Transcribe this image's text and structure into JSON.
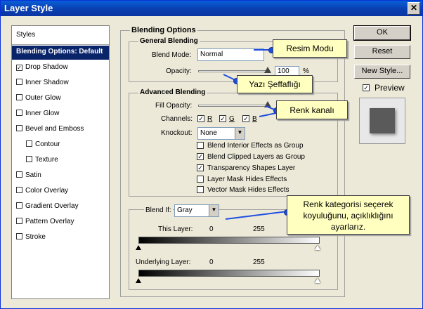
{
  "window": {
    "title": "Layer Style",
    "close_glyph": "✕"
  },
  "styles_panel": {
    "items": [
      {
        "label": "Styles",
        "checked": null,
        "selected": false
      },
      {
        "label": "Blending Options: Default",
        "checked": null,
        "selected": true
      },
      {
        "label": "Drop Shadow",
        "checked": true,
        "selected": false
      },
      {
        "label": "Inner Shadow",
        "checked": false,
        "selected": false
      },
      {
        "label": "Outer Glow",
        "checked": false,
        "selected": false
      },
      {
        "label": "Inner Glow",
        "checked": false,
        "selected": false
      },
      {
        "label": "Bevel and Emboss",
        "checked": false,
        "selected": false
      },
      {
        "label": "Contour",
        "checked": false,
        "selected": false
      },
      {
        "label": "Texture",
        "checked": false,
        "selected": false
      },
      {
        "label": "Satin",
        "checked": false,
        "selected": false
      },
      {
        "label": "Color Overlay",
        "checked": false,
        "selected": false
      },
      {
        "label": "Gradient Overlay",
        "checked": false,
        "selected": false
      },
      {
        "label": "Pattern Overlay",
        "checked": false,
        "selected": false
      },
      {
        "label": "Stroke",
        "checked": false,
        "selected": false
      }
    ]
  },
  "blending_options": {
    "title": "Blending Options",
    "general": {
      "title": "General Blending",
      "blend_mode_label": "Blend Mode:",
      "blend_mode_value": "Normal",
      "opacity_label": "Opacity:",
      "opacity_value": "100",
      "opacity_unit": "%"
    },
    "advanced": {
      "title": "Advanced Blending",
      "fill_opacity_label": "Fill Opacity:",
      "channels_label": "Channels:",
      "channel_r": "R",
      "channel_g": "G",
      "channel_b": "B",
      "knockout_label": "Knockout:",
      "knockout_value": "None",
      "options": [
        {
          "label": "Blend Interior Effects as Group",
          "checked": false
        },
        {
          "label": "Blend Clipped Layers as Group",
          "checked": true
        },
        {
          "label": "Transparency Shapes Layer",
          "checked": true
        },
        {
          "label": "Layer Mask Hides Effects",
          "checked": false
        },
        {
          "label": "Vector Mask Hides Effects",
          "checked": false
        }
      ]
    },
    "blend_if": {
      "label": "Blend If:",
      "value": "Gray",
      "this_layer_label": "This Layer:",
      "this_layer_min": "0",
      "this_layer_max": "255",
      "underlying_label": "Underlying Layer:",
      "underlying_min": "0",
      "underlying_max": "255"
    }
  },
  "buttons": {
    "ok": "OK",
    "reset": "Reset",
    "new_style": "New Style...",
    "preview_label": "Preview",
    "preview_checked": true
  },
  "callouts": {
    "resim_modu": "Resim Modu",
    "yazi_seffafligi": "Yazı Şeffaflığı",
    "renk_kanali": "Renk kanalı",
    "renk_kategorisi": "Renk kategorisi seçerek koyuluğunu, açıklıklığını ayarlarız."
  },
  "colors": {
    "title_bar": "#0a3fb0",
    "selected_item": "#0a246a",
    "callout_bg": "#ffffc0",
    "pointer": "#1f4fe0"
  }
}
